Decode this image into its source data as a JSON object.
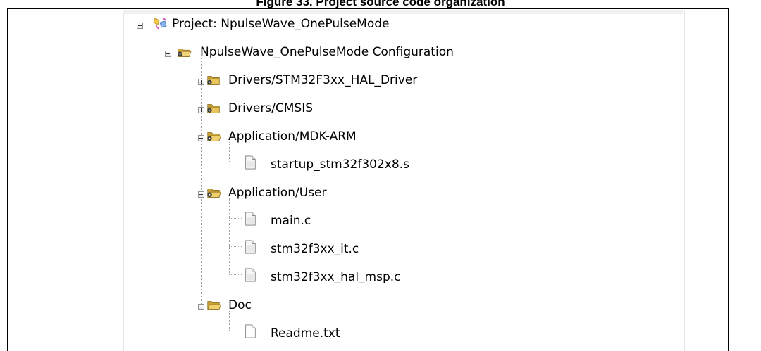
{
  "caption": "Figure 33. Project source code organization",
  "tree": {
    "project": {
      "label": "Project: NpulseWave_OnePulseMode",
      "expanded": true
    },
    "config": {
      "label": "NpulseWave_OnePulseMode Configuration",
      "expanded": true
    },
    "groups": [
      {
        "label": "Drivers/STM32F3xx_HAL_Driver",
        "expanded": false,
        "files": []
      },
      {
        "label": "Drivers/CMSIS",
        "expanded": false,
        "files": []
      },
      {
        "label": "Application/MDK-ARM",
        "expanded": true,
        "files": [
          "startup_stm32f302x8.s"
        ]
      },
      {
        "label": "Application/User",
        "expanded": true,
        "files": [
          "main.c",
          "stm32f3xx_it.c",
          "stm32f3xx_hal_msp.c"
        ]
      },
      {
        "label": "Doc",
        "expanded": true,
        "files": [
          "Readme.txt"
        ]
      }
    ]
  },
  "icons": {
    "project": "project-icon",
    "target": "target-options-icon",
    "group": "folder-icon",
    "file": "file-icon"
  }
}
